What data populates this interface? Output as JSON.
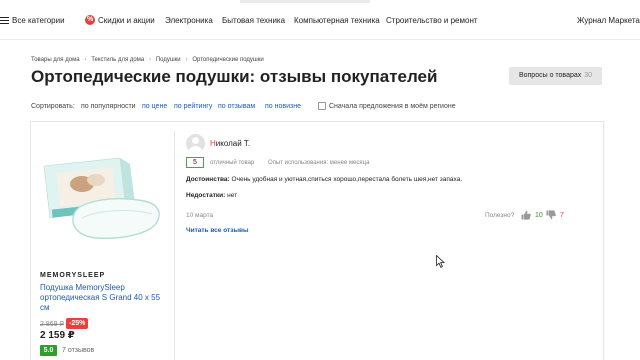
{
  "nav": {
    "all_categories": "Все категории",
    "items": [
      {
        "label": "Скидки и акции"
      },
      {
        "label": "Электроника"
      },
      {
        "label": "Бытовая техника"
      },
      {
        "label": "Компьютерная техника"
      },
      {
        "label": "Строительство и ремонт"
      }
    ],
    "journal": "Журнал Маркета",
    "promo_icon": "percent-icon"
  },
  "breadcrumb": [
    "Товары для дома",
    "Текстиль для дома",
    "Подушки",
    "Ортопедические подушки"
  ],
  "page_title": "Ортопедические подушки: отзывы покупателей",
  "questions_button": {
    "label": "Вопросы о товарах",
    "count": "30"
  },
  "sort": {
    "label": "Сортировать:",
    "options": [
      "по популярности",
      "по цене",
      "по рейтингу",
      "по отзывам",
      "по новизне"
    ],
    "active_index": 0,
    "region_checkbox_label": "Сначала предложения в моём регионе",
    "region_checked": false
  },
  "product": {
    "brand": "MEMORYSLEEP",
    "name": "Подушка MemorySleep ортопедическая S Grand 40 x 55 см",
    "old_price": "2 869 ₽",
    "discount": "-25%",
    "price": "2 159 ₽",
    "rating": "5.0",
    "reviews": "7 отзывов"
  },
  "review": {
    "author": "Николай Т.",
    "score": "5",
    "grade": "отличный товар",
    "usage": "Опыт использования: менее месяца",
    "pros_label": "Достоинства:",
    "pros": "Очень удобная и уютная,спиться хорошо,перестала болеть шея,нет запаха.",
    "cons_label": "Недостатки:",
    "cons": "нет",
    "date": "10 марта",
    "useful_label": "Полезно?",
    "useful_up": "10",
    "useful_down": "7",
    "read_all": "Читать все отзывы"
  },
  "colors": {
    "link": "#1a5bbd",
    "accent_red": "#e8413c",
    "rating_green": "#2e9e2e"
  }
}
